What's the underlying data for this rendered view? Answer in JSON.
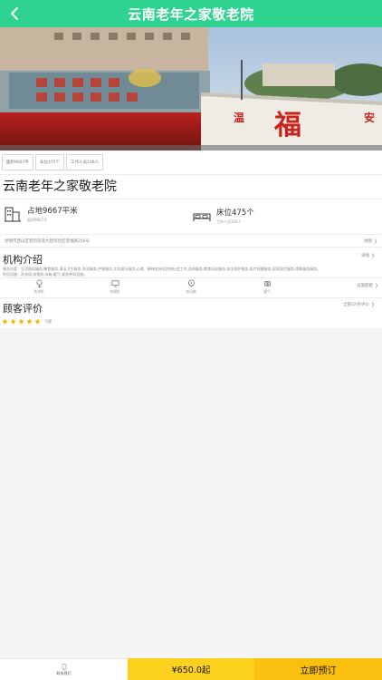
{
  "header": {
    "title": "云南老年之家敬老院"
  },
  "banner": {
    "slides": 4,
    "active_index": 0,
    "sign_characters": [
      "福",
      "温",
      "安"
    ]
  },
  "tags": [
    {
      "label": "面积9667平"
    },
    {
      "label": "床位475个"
    },
    {
      "label": "工作人员106人"
    }
  ],
  "facility_name": "云南老年之家敬老院",
  "stats": {
    "area": {
      "main": "占地9667平米",
      "sub": "面积9667平"
    },
    "beds": {
      "main": "床位475个",
      "sub": "工作人员106人"
    }
  },
  "address": {
    "text": "昆明市西山区碧鸡街道大碧鸡社区普福路256号",
    "map_label": "地图"
  },
  "intro": {
    "title": "机构介绍",
    "detail_label": "详情",
    "text_lines": [
      "服务内容：生活照料服务,膳食服务,清洁卫生服务,洗涤服务,护理服务,文化娱乐服务,心理、精神支持及其他社会工作,咨询服务,教育培训服务,安全保护服务,医疗保健服务,居家医疗服务,殡葬服务服务。",
      "附设设施：洗衣机,电视机,冰箱,暖气,紧急呼叫设施。"
    ]
  },
  "facilities": {
    "items": [
      {
        "label": "洗衣机",
        "icon": "washer-icon"
      },
      {
        "label": "电视机",
        "icon": "tv-icon"
      },
      {
        "label": "电风扇",
        "icon": "fan-icon"
      },
      {
        "label": "暖气",
        "icon": "heater-icon"
      }
    ],
    "more_label": "设施配套"
  },
  "reviews": {
    "title": "顾客评价",
    "all_label": "全部(0)条评价",
    "stars": 5,
    "score_label": "5星"
  },
  "bottom_bar": {
    "contact_label": "联系我们",
    "price_label": "¥650.0起",
    "book_label": "立即预订"
  },
  "colors": {
    "header_green": "#2ed38f",
    "star_yellow": "#f7b500",
    "price_yellow": "#fcd21f",
    "book_yellow": "#f9c010"
  }
}
